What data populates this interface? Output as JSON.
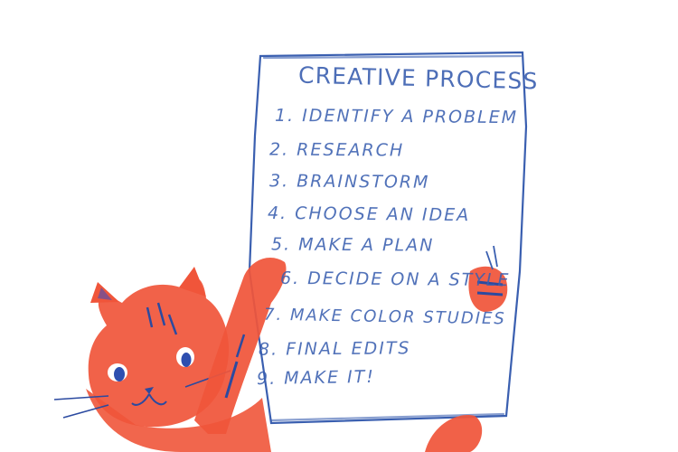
{
  "sign": {
    "title": "CREATIVE PROCESS",
    "steps": [
      "1. IDENTIFY A PROBLEM",
      "2. RESEARCH",
      "3. BRAINSTORM",
      "4. CHOOSE AN IDEA",
      "5. MAKE A PLAN",
      "6. DECIDE ON A STYLE",
      "7. MAKE COLOR STUDIES",
      "8. FINAL EDITS",
      "9. MAKE IT!"
    ]
  },
  "colors": {
    "ink_blue": "#3a5fb0",
    "cat_orange": "#f0553a",
    "cat_stripe": "#2b4aa0",
    "eye_blue": "#2e4fb0"
  }
}
